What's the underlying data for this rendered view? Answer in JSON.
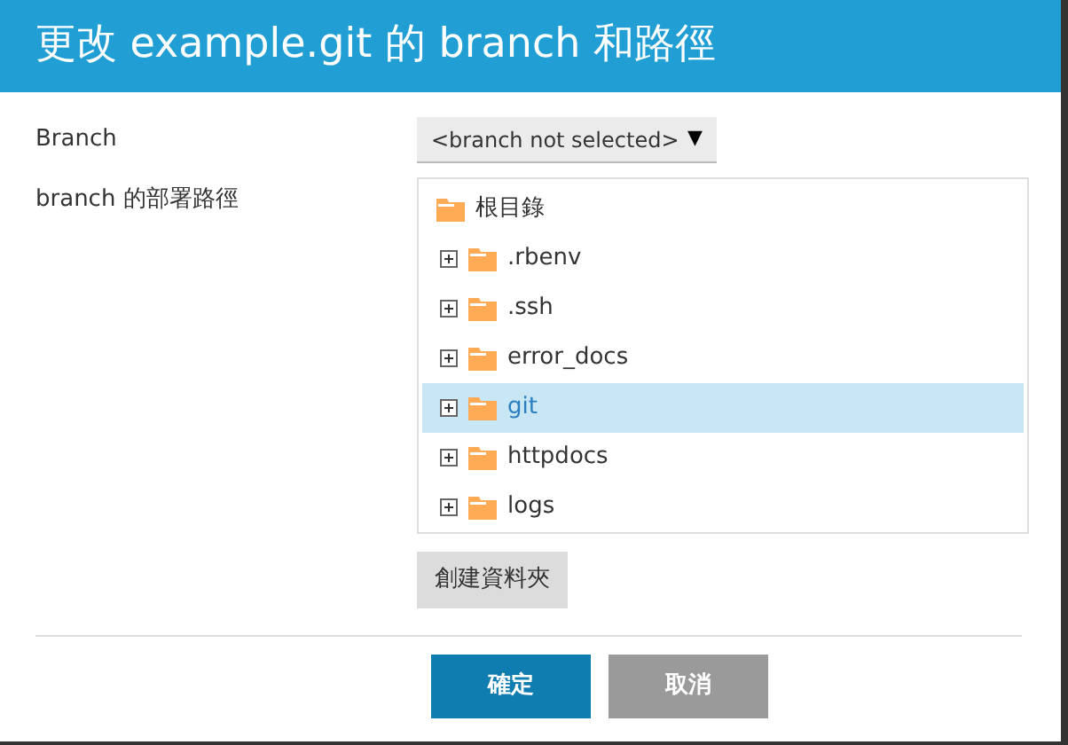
{
  "dialog": {
    "title": "更改 example.git 的 branch 和路徑"
  },
  "branch_field": {
    "label": "Branch",
    "value": "<branch not selected>",
    "arrow": "▼"
  },
  "path_field": {
    "label": "branch 的部署路徑",
    "tree": [
      {
        "label": "根目錄",
        "selected": false,
        "children": [
          {
            "label": ".rbenv",
            "expanded": false,
            "selected": false
          },
          {
            "label": ".ssh",
            "expanded": false,
            "selected": false
          },
          {
            "label": "error_docs",
            "expanded": false,
            "selected": false
          },
          {
            "label": "git",
            "expanded": false,
            "selected": true
          },
          {
            "label": "httpdocs",
            "expanded": false,
            "selected": false
          },
          {
            "label": "logs",
            "expanded": false,
            "selected": false
          }
        ]
      }
    ]
  },
  "create_folder_button": "創建資料夾",
  "buttons": [
    {
      "label": "確定",
      "kind": "primary"
    },
    {
      "label": "取消",
      "kind": "secondary"
    }
  ]
}
